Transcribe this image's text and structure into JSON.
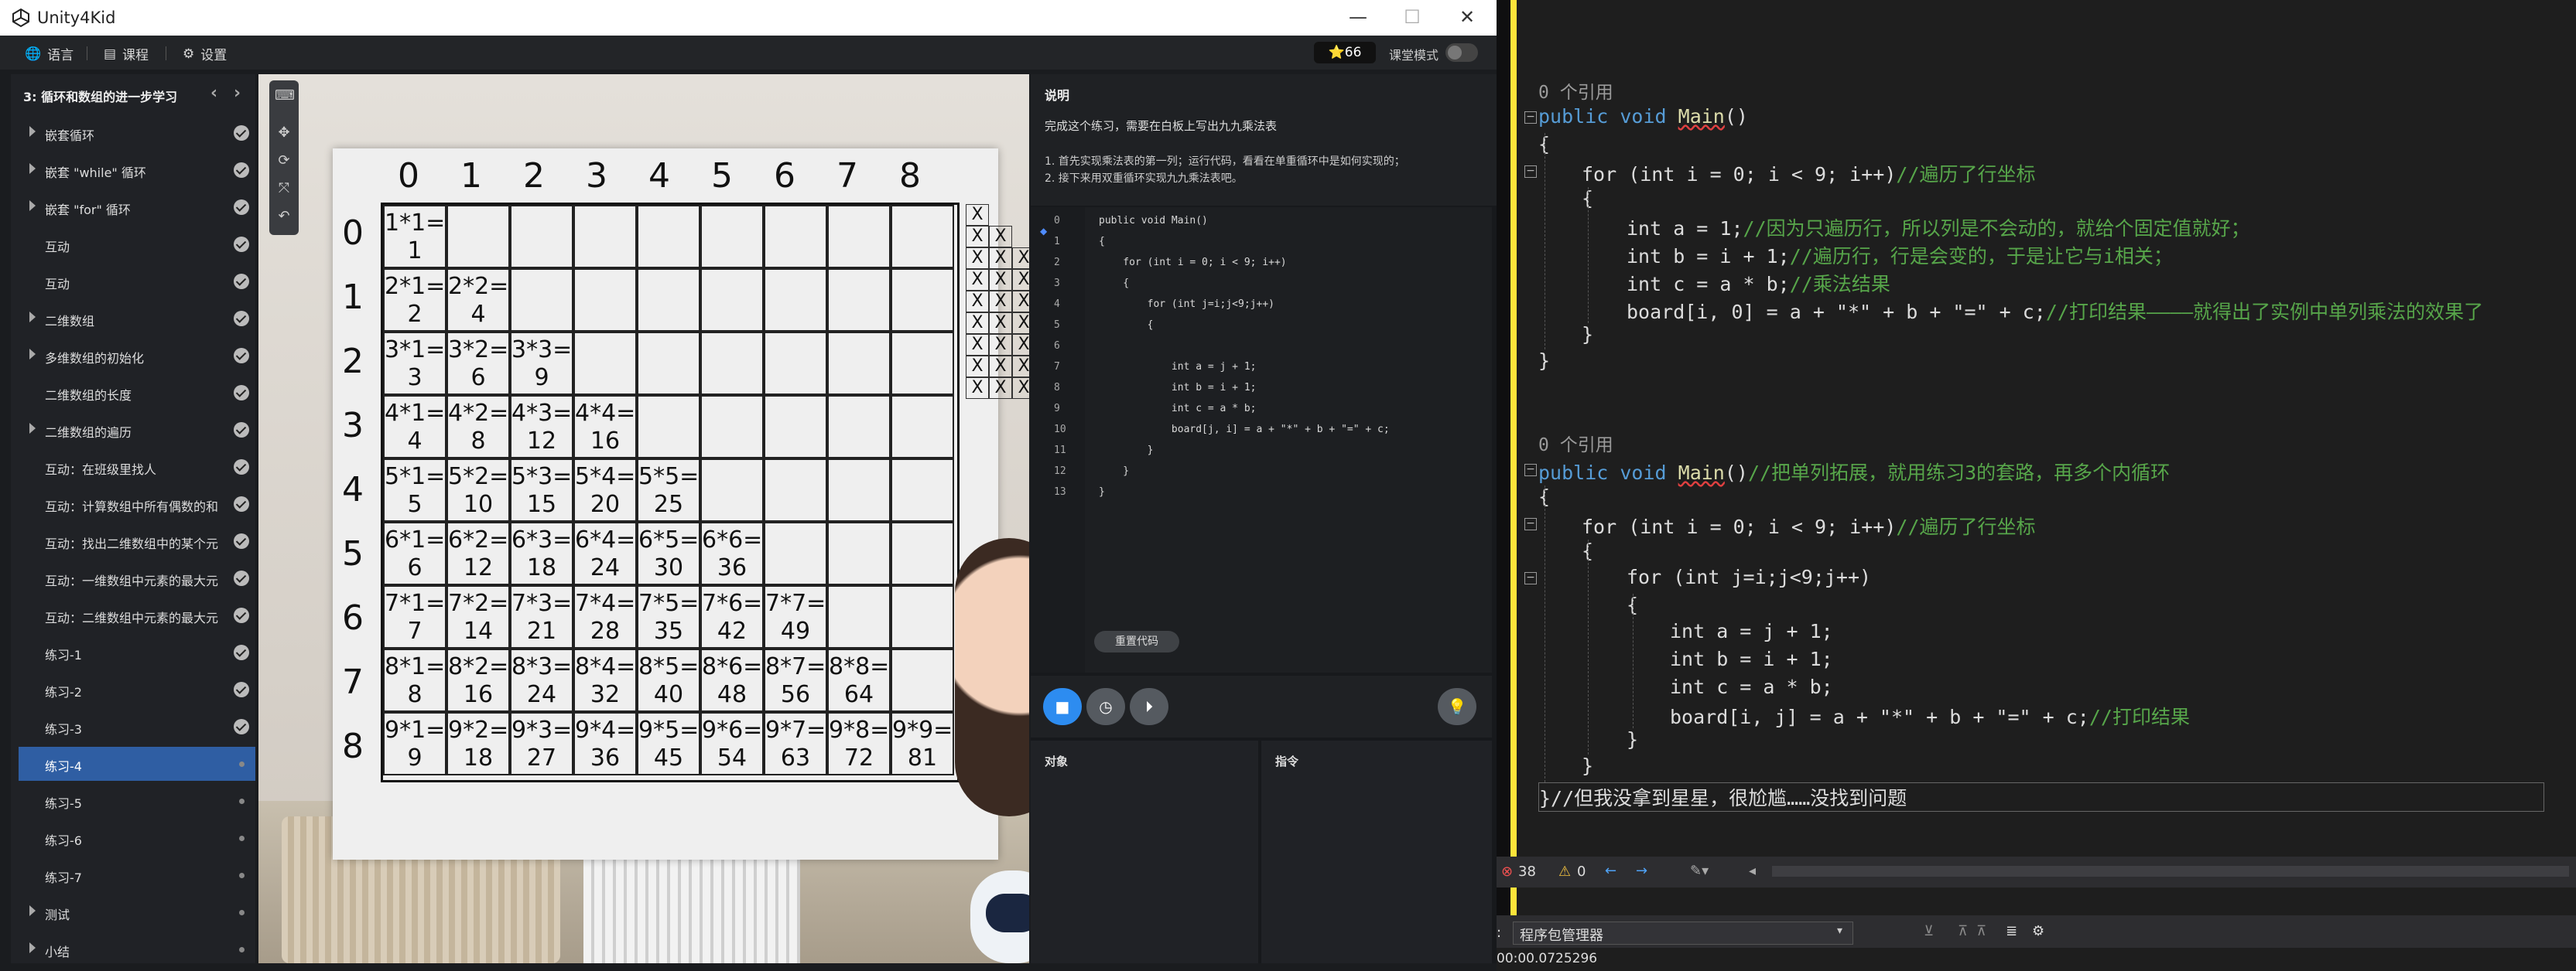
{
  "app": {
    "title": "Unity4Kid",
    "minimize": "—",
    "maximize": "☐",
    "close": "✕"
  },
  "appbar": {
    "language": "语言",
    "course": "课程",
    "settings": "设置",
    "stars": "⭐66",
    "class_mode": "课堂模式"
  },
  "sidebar": {
    "title": "3: 循环和数组的进一步学习",
    "items": [
      {
        "label": "嵌套循环",
        "expandable": true,
        "done": true
      },
      {
        "label": "嵌套 \"while\" 循环",
        "expandable": true,
        "done": true
      },
      {
        "label": "嵌套 \"for\" 循环",
        "expandable": true,
        "done": true
      },
      {
        "label": "互动",
        "expandable": false,
        "done": true
      },
      {
        "label": "互动",
        "expandable": false,
        "done": true
      },
      {
        "label": "二维数组",
        "expandable": true,
        "done": true
      },
      {
        "label": "多维数组的初始化",
        "expandable": true,
        "done": true
      },
      {
        "label": "二维数组的长度",
        "expandable": false,
        "done": true
      },
      {
        "label": "二维数组的遍历",
        "expandable": true,
        "done": true
      },
      {
        "label": "互动：在班级里找人",
        "expandable": false,
        "done": true
      },
      {
        "label": "互动：计算数组中所有偶数的和",
        "expandable": false,
        "done": true
      },
      {
        "label": "互动：找出二维数组中的某个元",
        "expandable": false,
        "done": true
      },
      {
        "label": "互动：一维数组中元素的最大元",
        "expandable": false,
        "done": true
      },
      {
        "label": "互动：二维数组中元素的最大元",
        "expandable": false,
        "done": true
      },
      {
        "label": "练习-1",
        "expandable": false,
        "done": true
      },
      {
        "label": "练习-2",
        "expandable": false,
        "done": true
      },
      {
        "label": "练习-3",
        "expandable": false,
        "done": true
      },
      {
        "label": "练习-4",
        "expandable": false,
        "done": false,
        "active": true
      },
      {
        "label": "练习-5",
        "expandable": false,
        "done": false
      },
      {
        "label": "练习-6",
        "expandable": false,
        "done": false
      },
      {
        "label": "练习-7",
        "expandable": false,
        "done": false
      },
      {
        "label": "测试",
        "expandable": true,
        "done": false
      },
      {
        "label": "小结",
        "expandable": true,
        "done": false
      }
    ]
  },
  "board": {
    "col_headers": [
      "0",
      "1",
      "2",
      "3",
      "4",
      "5",
      "6",
      "7",
      "8"
    ],
    "row_headers": [
      "0",
      "1",
      "2",
      "3",
      "4",
      "5",
      "6",
      "7",
      "8"
    ],
    "rows": [
      [
        [
          "1*1=",
          "1"
        ]
      ],
      [
        [
          "2*1=",
          "2"
        ],
        [
          "2*2=",
          "4"
        ]
      ],
      [
        [
          "3*1=",
          "3"
        ],
        [
          "3*2=",
          "6"
        ],
        [
          "3*3=",
          "9"
        ]
      ],
      [
        [
          "4*1=",
          "4"
        ],
        [
          "4*2=",
          "8"
        ],
        [
          "4*3=",
          "12"
        ],
        [
          "4*4=",
          "16"
        ]
      ],
      [
        [
          "5*1=",
          "5"
        ],
        [
          "5*2=",
          "10"
        ],
        [
          "5*3=",
          "15"
        ],
        [
          "5*4=",
          "20"
        ],
        [
          "5*5=",
          "25"
        ]
      ],
      [
        [
          "6*1=",
          "6"
        ],
        [
          "6*2=",
          "12"
        ],
        [
          "6*3=",
          "18"
        ],
        [
          "6*4=",
          "24"
        ],
        [
          "6*5=",
          "30"
        ],
        [
          "6*6=",
          "36"
        ]
      ],
      [
        [
          "7*1=",
          "7"
        ],
        [
          "7*2=",
          "14"
        ],
        [
          "7*3=",
          "21"
        ],
        [
          "7*4=",
          "28"
        ],
        [
          "7*5=",
          "35"
        ],
        [
          "7*6=",
          "42"
        ],
        [
          "7*7=",
          "49"
        ]
      ],
      [
        [
          "8*1=",
          "8"
        ],
        [
          "8*2=",
          "16"
        ],
        [
          "8*3=",
          "24"
        ],
        [
          "8*4=",
          "32"
        ],
        [
          "8*5=",
          "40"
        ],
        [
          "8*6=",
          "48"
        ],
        [
          "8*7=",
          "56"
        ],
        [
          "8*8=",
          "64"
        ]
      ],
      [
        [
          "9*1=",
          "9"
        ],
        [
          "9*2=",
          "18"
        ],
        [
          "9*3=",
          "27"
        ],
        [
          "9*4=",
          "36"
        ],
        [
          "9*5=",
          "45"
        ],
        [
          "9*6=",
          "54"
        ],
        [
          "9*7=",
          "63"
        ],
        [
          "9*8=",
          "72"
        ],
        [
          "9*9=",
          "81"
        ]
      ]
    ],
    "mark_counts": [
      1,
      2,
      3,
      3,
      3,
      3,
      3,
      3,
      3
    ],
    "mark_char": "X"
  },
  "instructions": {
    "heading": "说明",
    "text": "完成这个练习，需要在白板上写出九九乘法表",
    "step1": "1. 首先实现乘法表的第一列；运行代码，看看在单重循环中是如何实现的；",
    "step2": "2. 接下来用双重循环实现九九乘法表吧。"
  },
  "editor": {
    "reset_label": "重置代码",
    "lines": [
      "public void Main()",
      "{",
      "    for (int i = 0; i < 9; i++)",
      "    {",
      "        for (int j=i;j<9;j++)",
      "        {",
      "",
      "            int a = j + 1;",
      "            int b = i + 1;",
      "            int c = a * b;",
      "            board[j, i] = a + \"*\" + b + \"=\" + c;",
      "        }",
      "    }",
      "}"
    ]
  },
  "panels": {
    "objects": "对象",
    "commands": "指令"
  },
  "vs": {
    "ref1": "0 个引用",
    "ref2": "0 个引用",
    "l1": "public void Main()",
    "l2": "{",
    "l3a": "for (int i = 0; i < 9; i++)",
    "l3c": "//遍历了行坐标",
    "l4": "{",
    "l5a": "int a = 1;",
    "l5c": "//因为只遍历行，所以列是不会动的，就给个固定值就好；",
    "l6a": "int b = i + 1;",
    "l6c": "//遍历行，行是会变的，于是让它与i相关；",
    "l7a": "int c = a * b;",
    "l7c": "//乘法结果",
    "l8a": "board[i, 0] = a + \"*\" + b + \"=\" + c;",
    "l8c": "//打印结果————就得出了实例中单列乘法的效果了",
    "l9": "}",
    "l10": "}",
    "m1": "public void Main()",
    "m1c": "//把单列拓展，就用练习3的套路，再多个内循环",
    "m2": "{",
    "m3a": "for (int i = 0; i < 9; i++)",
    "m3c": "//遍历了行坐标",
    "m4": "{",
    "m5": "for (int j=i;j<9;j++)",
    "m6": "{",
    "m7": "int a = j + 1;",
    "m8": "int b = i + 1;",
    "m9": "int c = a * b;",
    "m10a": "board[i, j] = a + \"*\" + b + \"=\" + c;",
    "m10c": "//打印结果",
    "m11": "}",
    "m12": "}",
    "m13": "}//但我没拿到星星，很尬尴……没找到问题",
    "errors": "38",
    "warnings": "0",
    "pkg_label": "程序包管理器",
    "time": "00:00.0725296"
  }
}
